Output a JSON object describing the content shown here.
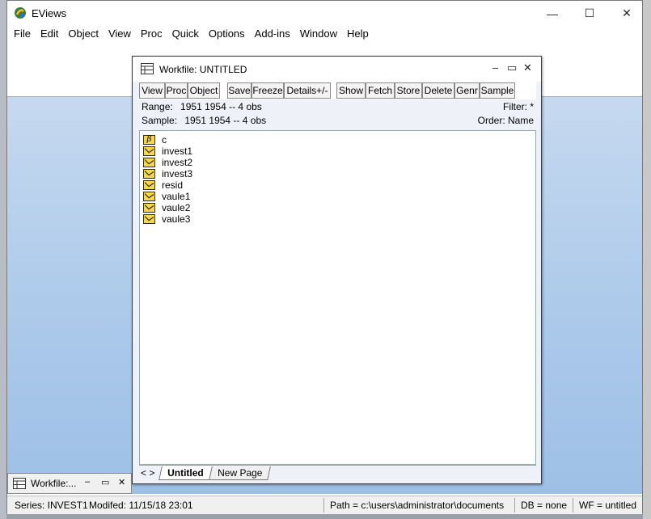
{
  "app": {
    "title": "EViews",
    "icon": "eviews-logo-icon",
    "controls": {
      "minimize": "—",
      "maximize": "☐",
      "close": "✕"
    }
  },
  "menubar": [
    "File",
    "Edit",
    "Object",
    "View",
    "Proc",
    "Quick",
    "Options",
    "Add-ins",
    "Window",
    "Help"
  ],
  "workfile": {
    "title": "Workfile: UNTITLED",
    "icon": "workfile-icon",
    "controls": {
      "minimize": "–",
      "restore": "▭",
      "close": "✕"
    },
    "toolbar": [
      "View",
      "Proc",
      "Object",
      "Save",
      "Freeze",
      "Details+/-",
      "Show",
      "Fetch",
      "Store",
      "Delete",
      "Genr",
      "Sample"
    ],
    "range": {
      "label": "Range:",
      "value": "1951 1954  --  4 obs"
    },
    "sample": {
      "label": "Sample:",
      "value": "1951 1954  --  4 obs"
    },
    "filter": "Filter: *",
    "order": "Order: Name",
    "objects": [
      {
        "name": "c",
        "type": "coef-icon"
      },
      {
        "name": "invest1",
        "type": "series-icon"
      },
      {
        "name": "invest2",
        "type": "series-icon"
      },
      {
        "name": "invest3",
        "type": "series-icon"
      },
      {
        "name": "resid",
        "type": "series-icon"
      },
      {
        "name": "vaule1",
        "type": "series-icon"
      },
      {
        "name": "vaule2",
        "type": "series-icon"
      },
      {
        "name": "vaule3",
        "type": "series-icon"
      }
    ],
    "tabs": {
      "nav": "< >",
      "active": "Untitled",
      "new": "New Page"
    }
  },
  "minimized": {
    "label": "Workfile:...",
    "icon": "workfile-icon"
  },
  "statusbar": {
    "series": "Series: INVEST1",
    "modified": "Modifed: 11/15/18  23:01",
    "path": "Path = c:\\users\\administrator\\documents",
    "db": "DB = none",
    "wf": "WF = untitled"
  }
}
